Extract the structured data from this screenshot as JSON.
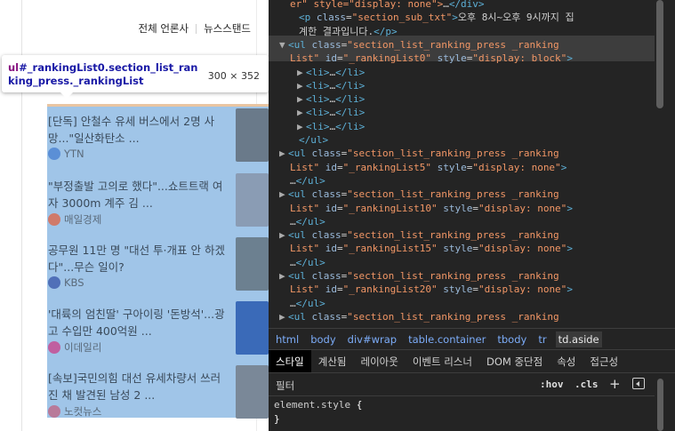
{
  "page": {
    "tabs": [
      {
        "label": "전체 언론사"
      },
      {
        "label": "뉴스스탠드"
      }
    ],
    "tooltip": {
      "tag": "ul",
      "selector": "#_rankingList0.section_list_ranking_press._rankingList",
      "dims": "300 × 352"
    },
    "news": [
      {
        "headline": "[단독] 안철수 유세 버스에서 2명 사망...\"일산화탄소 ...",
        "press": "YTN",
        "logo_color": "#5b8fd6",
        "thumb_color": "#6a7a8a"
      },
      {
        "headline": "\"부정출발 고의로 했다\"...쇼트트랙 여자 3000m 계주 김 ...",
        "press": "매일경제",
        "logo_color": "#d07a6a",
        "thumb_color": "#8a9cb4"
      },
      {
        "headline": "공무원 11만 명 \"대선 투·개표 안 하겠다\"...무슨 일이?",
        "press": "KBS",
        "logo_color": "#5070b8",
        "thumb_color": "#6c8090"
      },
      {
        "headline": "'대륙의 엄친딸' 구아이링 '돈방석'...광고 수입만 400억원 ...",
        "press": "이데일리",
        "logo_color": "#c060a0",
        "thumb_color": "#3a6ab8"
      },
      {
        "headline": "[속보]국민의힘 대선 유세차량서 쓰러진 채 발견된 남성 2 ...",
        "press": "노컷뉴스",
        "logo_color": "#b87a9a",
        "thumb_color": "#7a8898"
      }
    ]
  },
  "elements": {
    "lines": [
      {
        "indent": 0,
        "parts": [
          [
            "av",
            "er\" style=\"display: none\">"
          ],
          [
            "tx",
            "…"
          ],
          [
            "t",
            "</div>"
          ]
        ]
      },
      {
        "indent": 1,
        "parts": [
          [
            "t",
            "<p "
          ],
          [
            "an",
            "class"
          ],
          [
            "tx",
            "="
          ],
          [
            "av",
            "\"section_sub_txt\""
          ],
          [
            "t",
            ">"
          ],
          [
            "tx",
            "오후 8시~오후 9시까지 집"
          ]
        ]
      },
      {
        "indent": 1,
        "parts": [
          [
            "tx",
            "계한 결과입니다."
          ],
          [
            "t",
            "</p>"
          ]
        ]
      },
      {
        "indent": 0,
        "tri": "▼",
        "selected": true,
        "parts": [
          [
            "t",
            "<ul "
          ],
          [
            "an",
            "class"
          ],
          [
            "tx",
            "="
          ],
          [
            "av",
            "\"section_list_ranking_press _ranking"
          ]
        ]
      },
      {
        "indent": 0,
        "selected": true,
        "parts": [
          [
            "av",
            "List\""
          ],
          [
            "tx",
            " "
          ],
          [
            "an",
            "id"
          ],
          [
            "tx",
            "="
          ],
          [
            "av",
            "\"_rankingList0\""
          ],
          [
            "tx",
            " "
          ],
          [
            "an",
            "style"
          ],
          [
            "tx",
            "="
          ],
          [
            "av",
            "\"display: block\""
          ],
          [
            "t",
            ">"
          ]
        ]
      },
      {
        "indent": 2,
        "tri": "▶",
        "parts": [
          [
            "t",
            "<li>"
          ],
          [
            "tx",
            "…"
          ],
          [
            "t",
            "</li>"
          ]
        ]
      },
      {
        "indent": 2,
        "tri": "▶",
        "parts": [
          [
            "t",
            "<li>"
          ],
          [
            "tx",
            "…"
          ],
          [
            "t",
            "</li>"
          ]
        ]
      },
      {
        "indent": 2,
        "tri": "▶",
        "parts": [
          [
            "t",
            "<li>"
          ],
          [
            "tx",
            "…"
          ],
          [
            "t",
            "</li>"
          ]
        ]
      },
      {
        "indent": 2,
        "tri": "▶",
        "parts": [
          [
            "t",
            "<li>"
          ],
          [
            "tx",
            "…"
          ],
          [
            "t",
            "</li>"
          ]
        ]
      },
      {
        "indent": 2,
        "tri": "▶",
        "parts": [
          [
            "t",
            "<li>"
          ],
          [
            "tx",
            "…"
          ],
          [
            "t",
            "</li>"
          ]
        ]
      },
      {
        "indent": 1,
        "parts": [
          [
            "t",
            "</ul>"
          ]
        ]
      },
      {
        "indent": 0,
        "tri": "▶",
        "parts": [
          [
            "t",
            "<ul "
          ],
          [
            "an",
            "class"
          ],
          [
            "tx",
            "="
          ],
          [
            "av",
            "\"section_list_ranking_press _ranking"
          ]
        ]
      },
      {
        "indent": 0,
        "parts": [
          [
            "av",
            "List\""
          ],
          [
            "tx",
            " "
          ],
          [
            "an",
            "id"
          ],
          [
            "tx",
            "="
          ],
          [
            "av",
            "\"_rankingList5\""
          ],
          [
            "tx",
            " "
          ],
          [
            "an",
            "style"
          ],
          [
            "tx",
            "="
          ],
          [
            "av",
            "\"display: none\""
          ],
          [
            "t",
            ">"
          ]
        ]
      },
      {
        "indent": 0,
        "parts": [
          [
            "tx",
            "…"
          ],
          [
            "t",
            "</ul>"
          ]
        ]
      },
      {
        "indent": 0,
        "tri": "▶",
        "parts": [
          [
            "t",
            "<ul "
          ],
          [
            "an",
            "class"
          ],
          [
            "tx",
            "="
          ],
          [
            "av",
            "\"section_list_ranking_press _ranking"
          ]
        ]
      },
      {
        "indent": 0,
        "parts": [
          [
            "av",
            "List\""
          ],
          [
            "tx",
            " "
          ],
          [
            "an",
            "id"
          ],
          [
            "tx",
            "="
          ],
          [
            "av",
            "\"_rankingList10\""
          ],
          [
            "tx",
            " "
          ],
          [
            "an",
            "style"
          ],
          [
            "tx",
            "="
          ],
          [
            "av",
            "\"display: none\""
          ],
          [
            "t",
            ">"
          ]
        ]
      },
      {
        "indent": 0,
        "parts": [
          [
            "tx",
            "…"
          ],
          [
            "t",
            "</ul>"
          ]
        ]
      },
      {
        "indent": 0,
        "tri": "▶",
        "parts": [
          [
            "t",
            "<ul "
          ],
          [
            "an",
            "class"
          ],
          [
            "tx",
            "="
          ],
          [
            "av",
            "\"section_list_ranking_press _ranking"
          ]
        ]
      },
      {
        "indent": 0,
        "parts": [
          [
            "av",
            "List\""
          ],
          [
            "tx",
            " "
          ],
          [
            "an",
            "id"
          ],
          [
            "tx",
            "="
          ],
          [
            "av",
            "\"_rankingList15\""
          ],
          [
            "tx",
            " "
          ],
          [
            "an",
            "style"
          ],
          [
            "tx",
            "="
          ],
          [
            "av",
            "\"display: none\""
          ],
          [
            "t",
            ">"
          ]
        ]
      },
      {
        "indent": 0,
        "parts": [
          [
            "tx",
            "…"
          ],
          [
            "t",
            "</ul>"
          ]
        ]
      },
      {
        "indent": 0,
        "tri": "▶",
        "parts": [
          [
            "t",
            "<ul "
          ],
          [
            "an",
            "class"
          ],
          [
            "tx",
            "="
          ],
          [
            "av",
            "\"section_list_ranking_press _ranking"
          ]
        ]
      },
      {
        "indent": 0,
        "parts": [
          [
            "av",
            "List\""
          ],
          [
            "tx",
            " "
          ],
          [
            "an",
            "id"
          ],
          [
            "tx",
            "="
          ],
          [
            "av",
            "\"_rankingList20\""
          ],
          [
            "tx",
            " "
          ],
          [
            "an",
            "style"
          ],
          [
            "tx",
            "="
          ],
          [
            "av",
            "\"display: none\""
          ],
          [
            "t",
            ">"
          ]
        ]
      },
      {
        "indent": 0,
        "parts": [
          [
            "tx",
            "…"
          ],
          [
            "t",
            "</ul>"
          ]
        ]
      },
      {
        "indent": 0,
        "tri": "▶",
        "parts": [
          [
            "t",
            "<ul "
          ],
          [
            "an",
            "class"
          ],
          [
            "tx",
            "="
          ],
          [
            "av",
            "\"section_list_ranking_press _ranking"
          ]
        ]
      }
    ]
  },
  "breadcrumbs": [
    "html",
    "body",
    "div#wrap",
    "table.container",
    "tbody",
    "tr",
    "td.aside"
  ],
  "subtabs": [
    "스타일",
    "계산됨",
    "레이아웃",
    "이벤트 리스너",
    "DOM 중단점",
    "속성",
    "접근성"
  ],
  "styles": {
    "filter_placeholder": "필터",
    "hov_label": ":hov",
    "cls_label": ".cls",
    "plus_label": "+",
    "rule_selector": "element.style",
    "rule_open": "{",
    "rule_close": "}"
  }
}
